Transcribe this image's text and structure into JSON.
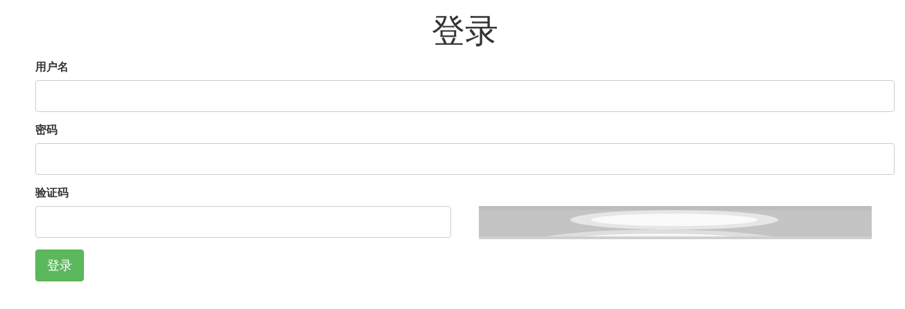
{
  "title": "登录",
  "fields": [
    {
      "label": "用户名",
      "kind": "text"
    },
    {
      "label": "密码",
      "kind": "password"
    },
    {
      "label": "验证码",
      "kind": "captcha"
    }
  ],
  "submit": "登录"
}
